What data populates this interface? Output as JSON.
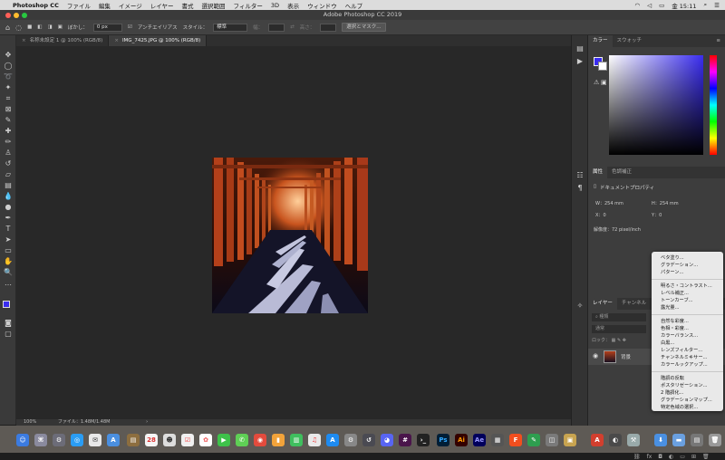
{
  "menubar": {
    "app_name": "Photoshop CC",
    "items": [
      "ファイル",
      "編集",
      "イメージ",
      "レイヤー",
      "書式",
      "選択範囲",
      "フィルター",
      "3D",
      "表示",
      "ウィンドウ",
      "ヘルプ"
    ],
    "clock": "金 15:11"
  },
  "window": {
    "title": "Adobe Photoshop CC 2019"
  },
  "options": {
    "feather_label": "ぼかし：",
    "feather_value": "0 px",
    "antialias_label": "アンチエイリアス",
    "style_label": "スタイル：",
    "style_value": "標準",
    "width_label": "幅：",
    "height_label": "高さ：",
    "select_mask_label": "選択とマスク..."
  },
  "tabs": [
    {
      "label": "名称未設定 1 @ 100% (RGB/8)"
    },
    {
      "label": "IMG_7425.JPG @ 100% (RGB/8)"
    }
  ],
  "status": {
    "zoom": "100%",
    "file_info": "ファイル：1.48M/1.48M"
  },
  "color_panel": {
    "tabs": [
      "カラー",
      "スウォッチ"
    ],
    "foreground": "#3a2df0",
    "hue_color": "#3a2df0"
  },
  "properties_panel": {
    "tabs": [
      "属性",
      "色調補正"
    ],
    "header": "ドキュメントプロパティ",
    "w_label": "W：",
    "w_value": "254 mm",
    "h_label": "H：",
    "h_value": "254 mm",
    "x_label": "X：",
    "x_value": "0",
    "y_label": "Y：",
    "y_value": "0",
    "resolution": "解像度：72 pixel/inch"
  },
  "layers_panel": {
    "tabs": [
      "レイヤー",
      "チャンネル"
    ],
    "filter_placeholder": "種類",
    "blend_mode": "通常",
    "lock_label": "ロック：",
    "layer_name": "背景"
  },
  "adjustment_menu": {
    "groups": [
      [
        "ベタ塗り...",
        "グラデーション...",
        "パターン..."
      ],
      [
        "明るさ・コントラスト...",
        "レベル補正...",
        "トーンカーブ...",
        "露光量..."
      ],
      [
        "自然な彩度...",
        "色相・彩度...",
        "カラーバランス...",
        "白黒...",
        "レンズフィルター...",
        "チャンネルミキサー...",
        "カラールックアップ..."
      ],
      [
        "階調の反転",
        "ポスタリゼーション...",
        "2 階調化...",
        "グラデーションマップ...",
        "特定色域の選択..."
      ]
    ]
  }
}
